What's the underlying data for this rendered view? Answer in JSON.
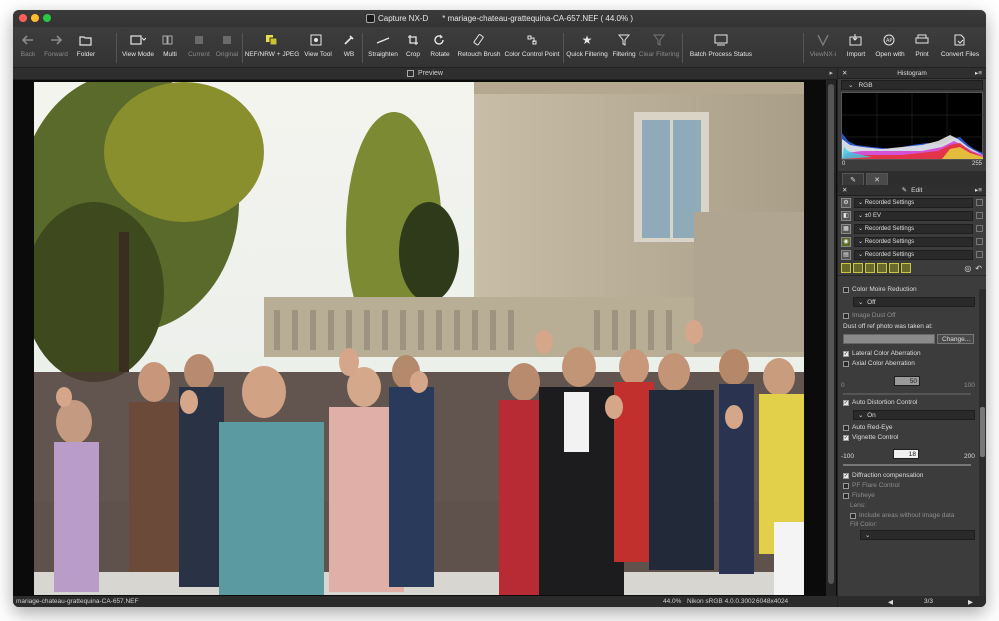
{
  "window": {
    "app_name": "Capture NX-D",
    "document_title": "* mariage-chateau-grattequina-CA-657.NEF ( 44.0% )"
  },
  "toolbar": {
    "buttons": [
      {
        "label": "Back",
        "icon": "arrow-left-icon",
        "enabled": false
      },
      {
        "label": "Forward",
        "icon": "arrow-right-icon",
        "enabled": false
      },
      {
        "label": "Folder",
        "icon": "folder-icon",
        "enabled": true
      },
      {
        "label": "View Mode",
        "icon": "view-mode-icon",
        "enabled": true
      },
      {
        "label": "Multi",
        "icon": "multi-view-icon",
        "enabled": false
      },
      {
        "label": "Current",
        "icon": "current-icon",
        "enabled": false
      },
      {
        "label": "Original",
        "icon": "original-icon",
        "enabled": false
      },
      {
        "label": "NEF/NRW + JPEG",
        "icon": "raw-jpeg-icon",
        "enabled": true
      },
      {
        "label": "View Tool",
        "icon": "view-tool-icon",
        "enabled": true
      },
      {
        "label": "WB",
        "icon": "eyedropper-icon",
        "enabled": true
      },
      {
        "label": "Straighten",
        "icon": "straighten-icon",
        "enabled": true
      },
      {
        "label": "Crop",
        "icon": "crop-icon",
        "enabled": true
      },
      {
        "label": "Rotate",
        "icon": "rotate-icon",
        "enabled": true
      },
      {
        "label": "Retouch Brush",
        "icon": "retouch-brush-icon",
        "enabled": true
      },
      {
        "label": "Color Control Point",
        "icon": "color-control-point-icon",
        "enabled": true
      },
      {
        "label": "Quick Filtering",
        "icon": "star-icon",
        "enabled": true
      },
      {
        "label": "Filtering",
        "icon": "filter-icon",
        "enabled": true
      },
      {
        "label": "Clear Filtering",
        "icon": "clear-filter-icon",
        "enabled": false
      },
      {
        "label": "Batch Process Status",
        "icon": "batch-process-icon",
        "enabled": true
      },
      {
        "label": "ViewNX-i",
        "icon": "viewnx-icon",
        "enabled": false
      },
      {
        "label": "Import",
        "icon": "import-icon",
        "enabled": true
      },
      {
        "label": "Open with",
        "icon": "open-with-icon",
        "enabled": true
      },
      {
        "label": "Print",
        "icon": "print-icon",
        "enabled": true
      },
      {
        "label": "Convert Files",
        "icon": "convert-files-icon",
        "enabled": true
      }
    ]
  },
  "preview": {
    "label": "Preview"
  },
  "status_bar": {
    "filename": "mariage-chateau-grattequina-CA-657.NEF",
    "zoom": "44.0%",
    "profile": "Nikon sRGB 4.0.0.3002",
    "dimensions": "6048x4024"
  },
  "histogram_panel": {
    "title": "Histogram",
    "channel": "RGB",
    "axis_min": "0",
    "axis_max": "255"
  },
  "edit_panel": {
    "title": "Edit",
    "steps": [
      {
        "label": "Recorded Settings",
        "icon": "camera-settings-icon"
      },
      {
        "label": "±0 EV",
        "icon": "exposure-icon"
      },
      {
        "label": "Recorded Settings",
        "icon": "picture-control-icon"
      },
      {
        "label": "Recorded Settings",
        "icon": "color-booster-icon"
      },
      {
        "label": "Recorded Settings",
        "icon": "noise-reduction-icon"
      }
    ],
    "sections": {
      "color_moire": "Color Moire Reduction",
      "color_moire_value": "Off",
      "image_dust_off": "Image Dust Off",
      "dust_ref_label": "Dust off ref photo was taken at:",
      "change_button": "Change...",
      "lateral_ca": "Lateral Color Aberration",
      "axial_ca": "Axial Color Aberration",
      "axial_min": "0",
      "axial_value": "50",
      "axial_max": "100",
      "auto_distortion": "Auto Distortion Control",
      "auto_distortion_value": "On",
      "auto_red_eye": "Auto Red-Eye",
      "vignette": "Vignette Control",
      "vignette_min": "-100",
      "vignette_value": "18",
      "vignette_max": "200",
      "diffraction": "Diffraction compensation",
      "pf_flare": "PF Flare Control",
      "fisheye": "Fisheye",
      "lens_label": "Lens:",
      "include_areas": "Include areas without image data",
      "fill_color": "Fill Color:"
    },
    "checks": {
      "lateral_ca": true,
      "axial_ca": false,
      "auto_distortion": true,
      "auto_red_eye": false,
      "vignette": true,
      "diffraction": true,
      "pf_flare": false,
      "fisheye": false,
      "include_areas": false
    }
  },
  "pager": {
    "page": "3/3"
  }
}
